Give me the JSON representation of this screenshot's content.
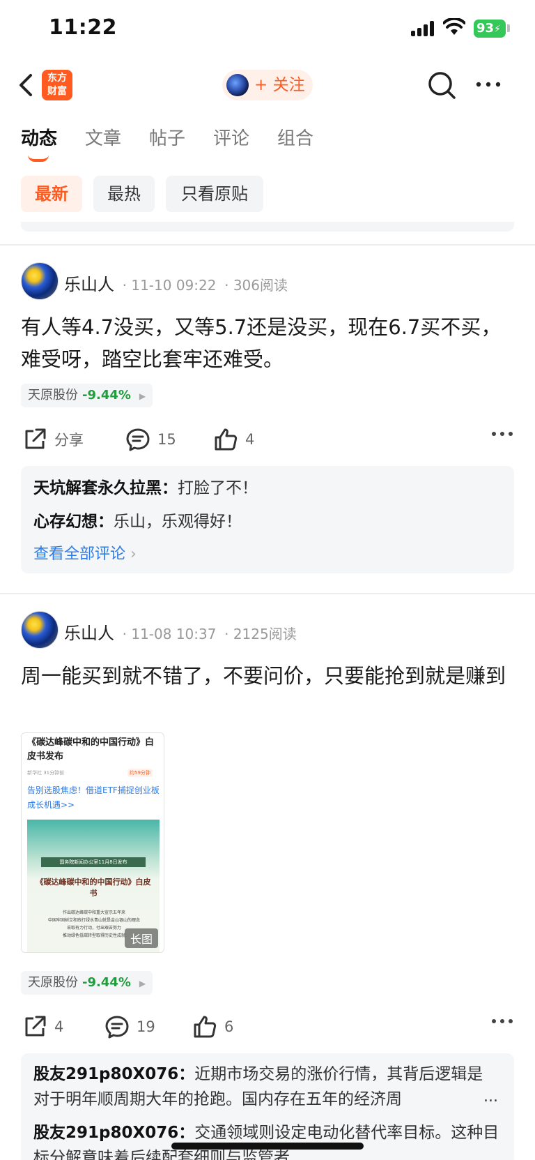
{
  "status_bar": {
    "time": "11:22",
    "battery": "93"
  },
  "nav": {
    "brand_line1": "东方",
    "brand_line2": "财富",
    "follow_label": "+ 关注"
  },
  "tabs": [
    "动态",
    "文章",
    "帖子",
    "评论",
    "组合"
  ],
  "active_tab": "动态",
  "filters": [
    "最新",
    "最热",
    "只看原贴"
  ],
  "active_filter": "最新",
  "posts": [
    {
      "author": "乐山人",
      "time": "· 11-10 09:22",
      "reads": "· 306阅读",
      "text": "有人等4.7没买，又等5.7还是没买，现在6.7买不买，难受呀，踏空比套牢还难受。",
      "stock_name": "天原股份",
      "stock_change": "-9.44%",
      "share": "分享",
      "comments": "15",
      "likes": "4",
      "comment_list": [
        {
          "name": "天坑解套永久拉黑",
          "sep": "：",
          "text": "打脸了不！"
        },
        {
          "name": "心存幻想",
          "sep": "：",
          "text": "乐山，乐观得好！"
        }
      ],
      "view_all": "查看全部评论"
    },
    {
      "author": "乐山人",
      "time": "· 11-08 10:37",
      "reads": "· 2125阅读",
      "text": "周一能买到就不错了，不要问价，只要能抢到就是赚到",
      "image": {
        "title": "《碳达峰碳中和的中国行动》白皮书发布",
        "source": "新华社 31分钟前",
        "audio": "约59分钟",
        "ad": "告别选股焦虑！借道ETF捕捉创业板成长机遇>>",
        "banner": "国务院新闻办公室11月8日发布",
        "cover_title": "《碳达峰碳中和的中国行动》白皮书",
        "cover_lines": [
          "作出碳达峰碳中和重大宣示五年来",
          "中国牢固树立和践行绿水青山就是金山银山的理念",
          "采取有力行动，付出艰苦努力",
          "推动绿色低碳转型取得历史性成就"
        ],
        "badge": "长图"
      },
      "stock_name": "天原股份",
      "stock_change": "-9.44%",
      "share": "4",
      "comments": "19",
      "likes": "6",
      "comment_list": [
        {
          "name": "股友291p80X076",
          "sep": "：",
          "text": "近期市场交易的涨价行情，其背后逻辑是对于明年顺周期大年的抢跑。国内存在五年的经济周"
        },
        {
          "name": "股友291p80X076",
          "sep": "：",
          "text": "交通领域则设定电动化替代率目标。这种目标分解意味着后续配套细则与监管者"
        }
      ],
      "ellipsis": "..."
    }
  ],
  "colors": {
    "accent": "#ff5a1f",
    "stock_down": "#1f9e3d",
    "link": "#2d7be5"
  }
}
